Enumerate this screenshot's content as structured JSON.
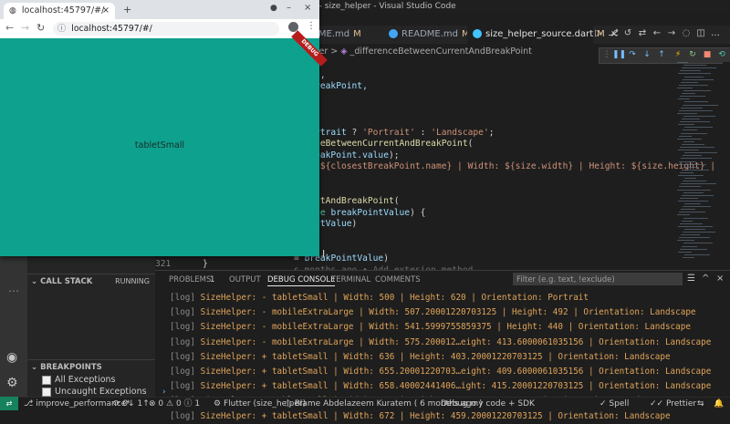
{
  "vscode": {
    "title": "ource.dart - size_helper - Visual Studio Code",
    "tabs": [
      {
        "label": "EADME.md",
        "mark": "M"
      },
      {
        "label": "README.md",
        "mark": "M"
      },
      {
        "label": "size_helper_source.dart",
        "mark": "M"
      }
    ],
    "breadcrumb": {
      "prefix": "eHelper",
      "sep": ">",
      "symbol": "_differenceBetweenCurrentAndBreakPoint"
    },
    "code_lines": [
      {
        "segments": [
          [
            "",
            "to:("
          ]
        ]
      },
      {
        "segments": [
          [
            "va",
            "ength,"
          ]
        ]
      },
      {
        "segments": [
          [
            "va",
            "estBreakPoint,"
          ]
        ]
      },
      {
        "segments": [
          [
            "",
            ""
          ]
        ]
      },
      {
        "segments": [
          [
            "",
            ","
          ]
        ]
      },
      {
        "segments": [
          [
            "",
            ""
          ]
        ]
      },
      {
        "segments": [
          [
            "va",
            "isPortrait"
          ],
          [
            "",
            " ? "
          ],
          [
            "str",
            "'Portrait'"
          ],
          [
            "",
            " : "
          ],
          [
            "str",
            "'Landscape'"
          ],
          [
            "",
            ";"
          ]
        ]
      },
      {
        "segments": [
          [
            "fn",
            "erenceBetweenCurrentAndBreakPoint"
          ],
          [
            "",
            "("
          ]
        ]
      },
      {
        "segments": [
          [
            "va",
            "stBreakPoint.value"
          ],
          [
            "",
            ");"
          ]
        ]
      },
      {
        "segments": [
          [
            "str",
            "ence ${closestBreakPoint.name} | Width: ${size.width} | Height: ${size.height} |"
          ]
        ]
      },
      {
        "segments": [
          [
            "",
            ""
          ]
        ]
      },
      {
        "segments": [
          [
            "",
            ""
          ]
        ]
      },
      {
        "segments": [
          [
            "fn",
            "urrentAndBreakPoint"
          ],
          [
            "",
            "("
          ]
        ]
      },
      {
        "segments": [
          [
            "ty",
            "double"
          ],
          [
            "",
            " "
          ],
          [
            "va",
            "breakPointValue"
          ],
          [
            "",
            ") {"
          ]
        ]
      },
      {
        "segments": [
          [
            "va",
            "kPointValue"
          ],
          [
            "",
            ")"
          ]
        ]
      },
      {
        "segments": [
          [
            "",
            ""
          ]
        ]
      },
      {
        "segments": [
          [
            "",
            ""
          ]
        ]
      },
      {
        "segments": [
          [
            "",
            "= "
          ],
          [
            "va",
            "breakPointValue"
          ],
          [
            "",
            ")"
          ]
        ]
      },
      {
        "segments": [
          [
            "blame",
            "s months ago • Add extesion method"
          ]
        ]
      }
    ],
    "gutter_line": "321",
    "gutter_code": "}",
    "panel": {
      "tabs": [
        "PROBLEMS",
        "1",
        "OUTPUT",
        "DEBUG CONSOLE",
        "TERMINAL",
        "COMMENTS"
      ],
      "filter_placeholder": "Filter (e.g. text, !exclude)",
      "logs": [
        "SizeHelper: - tabletSmall | Width: 500 | Height: 620 | Orientation: Portrait",
        "SizeHelper: - mobileExtraLarge | Width: 507.20001220703125 | Height: 492 | Orientation: Landscape",
        "SizeHelper: - mobileExtraLarge | Width: 541.5999755859375 | Height: 440 | Orientation: Landscape",
        "SizeHelper: - mobileExtraLarge | Width: 575.200012…eight: 413.6000061035156 | Orientation: Landscape",
        "SizeHelper: + tabletSmall | Width: 636 | Height: 403.20001220703125 | Orientation: Landscape",
        "SizeHelper: + tabletSmall | Width: 655.20001220703…eight: 409.6000061035156 | Orientation: Landscape",
        "SizeHelper: + tabletSmall | Width: 658.40002441406…ight: 415.20001220703125 | Orientation: Landscape",
        "SizeHelper: + tabletSmall | Width: 672 | Height: 458.3999938964844 | Orientation: Landscape",
        "SizeHelper: + tabletSmall | Width: 672 | Height: 459.20001220703125 | Orientation: Landscape"
      ],
      "log_tag": "[log]"
    },
    "side": {
      "call_stack": "CALL STACK",
      "running": "RUNNING",
      "breakpoints": "BREAKPOINTS",
      "bp_items": [
        "All Exceptions",
        "Uncaught Exceptions"
      ]
    },
    "status": {
      "branch": "improve_performance*",
      "sync": "0↓ 1↑",
      "errors": "0",
      "warnings": "0",
      "info": "1",
      "flutter": "Flutter (size_helper)",
      "blame": "Blame Abdelazeem Kuratem ( 6 months ago )",
      "debug": "Debug my code + SDK",
      "spell": "Spell",
      "prettier": "Prettier"
    }
  },
  "browser": {
    "tab_title": "localhost:45797/#/",
    "url": "localhost:45797/#/",
    "content_label": "tabletSmall",
    "debug_banner": "DEBUG",
    "viewport_color": "#0ea18d"
  }
}
